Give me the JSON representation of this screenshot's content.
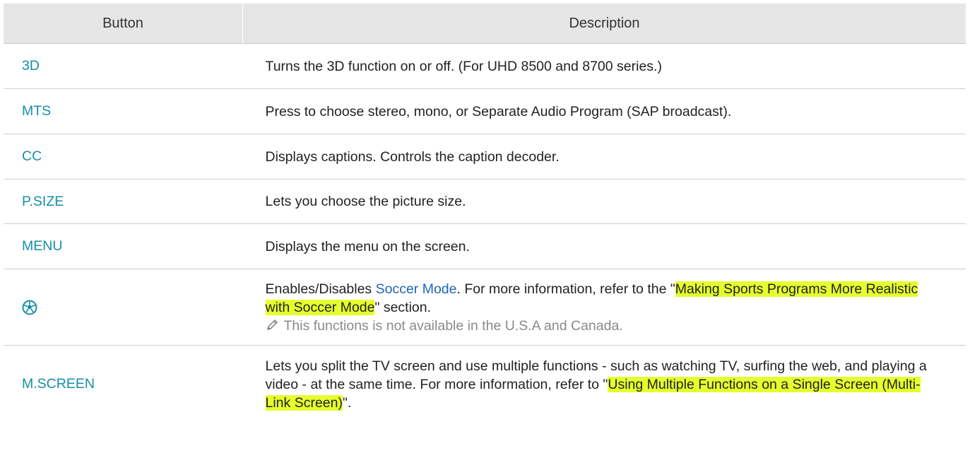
{
  "header": {
    "col_button": "Button",
    "col_description": "Description"
  },
  "rows": [
    {
      "button": "3D",
      "description": "Turns the 3D function on or off. (For UHD 8500 and 8700 series.)"
    },
    {
      "button": "MTS",
      "description": "Press to choose stereo, mono, or Separate Audio Program (SAP broadcast)."
    },
    {
      "button": "CC",
      "description": "Displays captions. Controls the caption decoder."
    },
    {
      "button": "P.SIZE",
      "description": "Lets you choose the picture size."
    },
    {
      "button": "MENU",
      "description": "Displays the menu on the screen."
    },
    {
      "button_icon": "soccer-ball-icon",
      "desc_part1": "Enables/Disables ",
      "term": "Soccer Mode",
      "desc_part2": ". For more information, refer to the \"",
      "link": "Making Sports Programs More Realistic with Soccer Mode",
      "desc_part3": "\" section.",
      "note_icon": "pencil-icon",
      "note": "This functions is not available in the U.S.A and Canada."
    },
    {
      "button": "M.SCREEN",
      "desc_part1": "Lets you split the TV screen and use multiple functions - such as watching TV, surfing the web, and playing a video - at the same time. For more information, refer to \"",
      "link": "Using Multiple Functions on a Single Screen (Multi-Link Screen)",
      "desc_part2": "\"."
    }
  ],
  "colors": {
    "button_text": "#168fa6",
    "term_text": "#1e66b4",
    "highlight": "#e6ff2e",
    "header_bg": "#e6e6e6",
    "note_text": "#8a8a8a"
  }
}
